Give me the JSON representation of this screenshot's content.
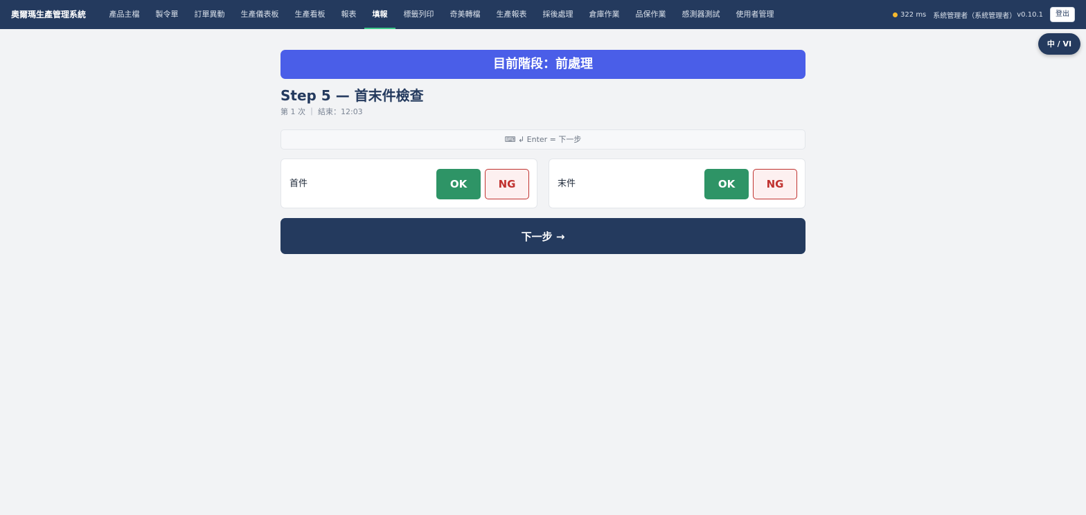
{
  "app": {
    "title": "奧爾瑪生產管理系統"
  },
  "nav": {
    "items": [
      {
        "label": "產品主檔"
      },
      {
        "label": "製令單"
      },
      {
        "label": "訂單異動"
      },
      {
        "label": "生產儀表板"
      },
      {
        "label": "生產看板"
      },
      {
        "label": "報表"
      },
      {
        "label": "填報",
        "active": true
      },
      {
        "label": "標籤列印"
      },
      {
        "label": "奇美轉檔"
      },
      {
        "label": "生產報表"
      },
      {
        "label": "採後處理"
      },
      {
        "label": "倉庫作業"
      },
      {
        "label": "品保作業"
      },
      {
        "label": "感測器測試"
      },
      {
        "label": "使用者管理"
      }
    ]
  },
  "status": {
    "latency": "322 ms",
    "dot_color": "#f5b82e",
    "user": "系統管理者（系統管理者）",
    "version": "v0.10.1",
    "logout_label": "登出"
  },
  "lang_toggle": "中 / VI",
  "stage_banner": "目前階段：前處理",
  "step": {
    "title": "Step 5 — 首末件檢查",
    "meta": "第 1 次 ｜ 結束：12:03"
  },
  "hint": "⌨ ↲ Enter = 下一步",
  "checks": [
    {
      "label": "首件",
      "ok_label": "OK",
      "ng_label": "NG"
    },
    {
      "label": "末件",
      "ok_label": "OK",
      "ng_label": "NG"
    }
  ],
  "next_button": "下一步 →",
  "colors": {
    "topbar": "#243a5e",
    "banner": "#4a5ee8",
    "ok": "#2e9466",
    "ng": "#c0322f",
    "active_underline": "#3cc98a"
  }
}
